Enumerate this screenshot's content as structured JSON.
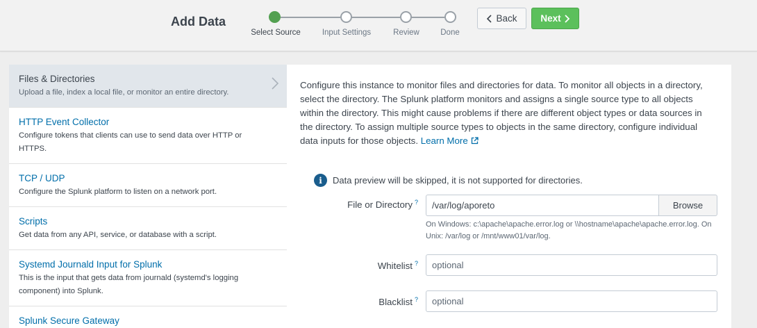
{
  "header": {
    "title": "Add Data",
    "steps": [
      {
        "label": "Select Source",
        "active": true
      },
      {
        "label": "Input Settings",
        "active": false
      },
      {
        "label": "Review",
        "active": false
      },
      {
        "label": "Done",
        "active": false
      }
    ],
    "back_label": "Back",
    "next_label": "Next"
  },
  "sources": [
    {
      "title": "Files & Directories",
      "desc": "Upload a file, index a local file, or monitor an entire directory.",
      "selected": true
    },
    {
      "title": "HTTP Event Collector",
      "desc": "Configure tokens that clients can use to send data over HTTP or HTTPS."
    },
    {
      "title": "TCP / UDP",
      "desc": "Configure the Splunk platform to listen on a network port."
    },
    {
      "title": "Scripts",
      "desc": "Get data from any API, service, or database with a script."
    },
    {
      "title": "Systemd Journald Input for Splunk",
      "desc": "This is the input that gets data from journald (systemd's logging component) into Splunk."
    },
    {
      "title": "Splunk Secure Gateway",
      "desc": ""
    }
  ],
  "panel": {
    "intro": "Configure this instance to monitor files and directories for data. To monitor all objects in a directory, select the directory. The Splunk platform monitors and assigns a single source type to all objects within the directory. This might cause problems if there are different object types or data sources in the directory. To assign multiple source types to objects in the same directory, configure individual data inputs for those objects.",
    "learn_more": "Learn More",
    "info_message": "Data preview will be skipped, it is not supported for directories.",
    "file_label": "File or Directory",
    "file_value": "/var/log/aporeto",
    "browse_label": "Browse",
    "file_help": "On Windows: c:\\apache\\apache.error.log or \\\\hostname\\apache\\apache.error.log. On Unix: /var/log or /mnt/www01/var/log.",
    "whitelist_label": "Whitelist",
    "whitelist_placeholder": "optional",
    "blacklist_label": "Blacklist",
    "blacklist_placeholder": "optional",
    "help_mark": "?"
  },
  "colors": {
    "accent_green": "#5cc05c",
    "link_blue": "#006eaa",
    "info_blue": "#1a5d8d",
    "selected_bg": "#e1e6eb"
  }
}
